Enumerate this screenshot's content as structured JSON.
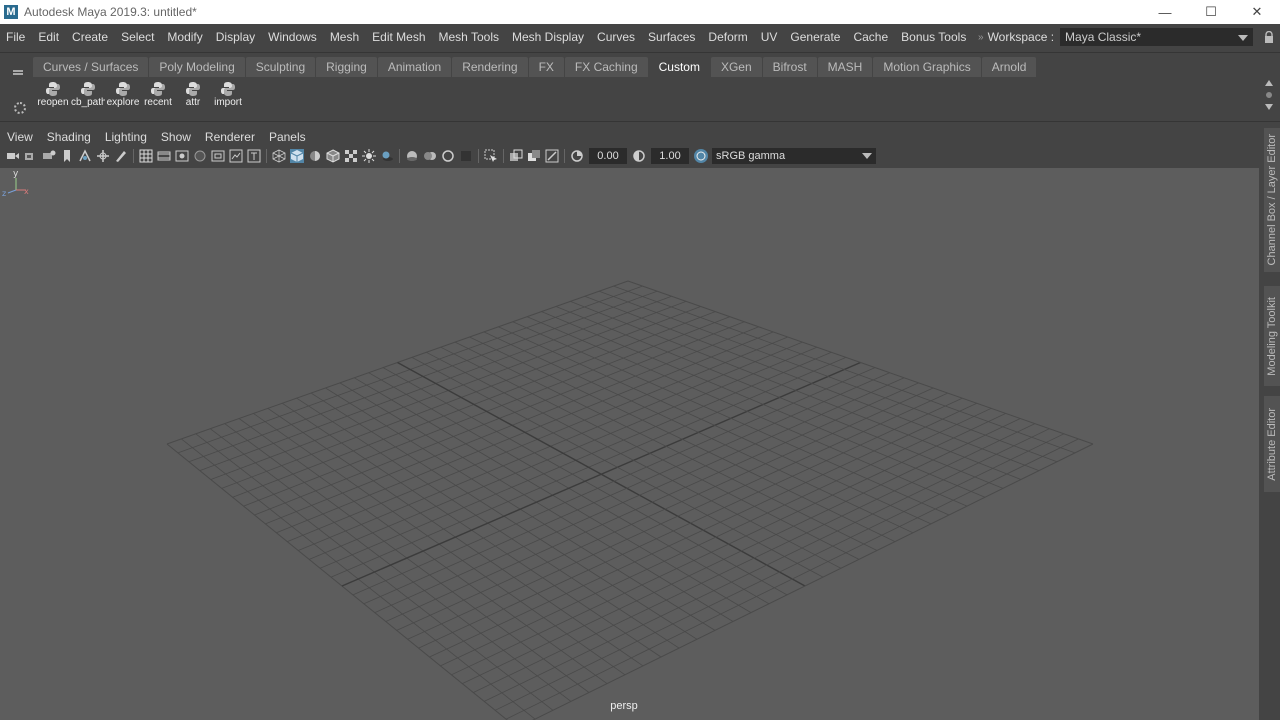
{
  "window": {
    "title": "Autodesk Maya 2019.3: untitled*",
    "logo_letter": "M",
    "controls": [
      "—",
      "☐",
      "✕"
    ]
  },
  "menubar": {
    "items": [
      "File",
      "Edit",
      "Create",
      "Select",
      "Modify",
      "Display",
      "Windows",
      "Mesh",
      "Edit Mesh",
      "Mesh Tools",
      "Mesh Display",
      "Curves",
      "Surfaces",
      "Deform",
      "UV",
      "Generate",
      "Cache",
      "Bonus Tools"
    ],
    "overflow_glyph": "»",
    "workspace_label": "Workspace :",
    "workspace_value": "Maya Classic*"
  },
  "shelf": {
    "tabs": [
      "Curves / Surfaces",
      "Poly Modeling",
      "Sculpting",
      "Rigging",
      "Animation",
      "Rendering",
      "FX",
      "FX Caching",
      "Custom",
      "XGen",
      "Bifrost",
      "MASH",
      "Motion Graphics",
      "Arnold"
    ],
    "active_tab": "Custom",
    "buttons": [
      {
        "label": "reopen",
        "icon": "python-icon"
      },
      {
        "label": "cb_path",
        "icon": "python-icon"
      },
      {
        "label": "explore",
        "icon": "python-icon"
      },
      {
        "label": "recent",
        "icon": "python-icon"
      },
      {
        "label": "attr",
        "icon": "python-icon"
      },
      {
        "label": "import",
        "icon": "python-icon"
      }
    ]
  },
  "panel": {
    "menu": [
      "View",
      "Shading",
      "Lighting",
      "Show",
      "Renderer",
      "Panels"
    ],
    "exposure": "0.00",
    "gamma": "1.00",
    "color_space": "sRGB gamma",
    "camera": "persp",
    "axis_y": "y",
    "axis_x": "x",
    "axis_z": "z"
  },
  "side_tabs": [
    "Channel Box / Layer Editor",
    "Modeling Toolkit",
    "Attribute Editor"
  ],
  "colors": {
    "ui_bg": "#444444",
    "viewport_bg": "#5d5d5d",
    "grid_line": "#4a4a4a",
    "grid_axis": "#3c3c3c",
    "active_icon": "#5285a6",
    "titlebar": "#ffffff"
  }
}
